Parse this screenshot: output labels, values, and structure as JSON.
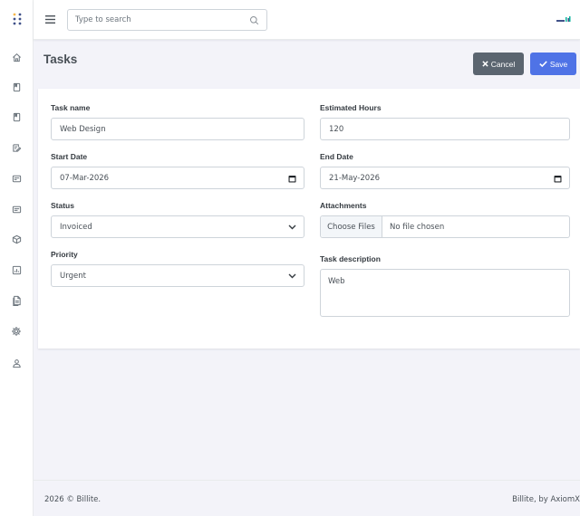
{
  "colors": {
    "accent": "#4f73e6",
    "cancel": "#5b6570",
    "logo": "#405189"
  },
  "sidebar": {
    "logo_icon": "dots-grid-icon",
    "items": [
      {
        "name": "home-icon"
      },
      {
        "name": "bookmark-icon"
      },
      {
        "name": "bookmark-outline-icon"
      },
      {
        "name": "edit-note-icon"
      },
      {
        "name": "wallet-icon"
      },
      {
        "name": "receipt-icon"
      },
      {
        "name": "box-icon"
      },
      {
        "name": "chart-icon"
      },
      {
        "name": "document-icon"
      },
      {
        "name": "settings-icon"
      },
      {
        "name": "user-icon"
      }
    ]
  },
  "topbar": {
    "search": {
      "placeholder": "Type to search",
      "value": ""
    }
  },
  "page": {
    "title": "Tasks",
    "cancel_label": "Cancel",
    "save_label": "Save"
  },
  "form": {
    "task_name": {
      "label": "Task name",
      "value": "Web Design"
    },
    "estimated_hours": {
      "label": "Estimated Hours",
      "value": "120"
    },
    "start_date": {
      "label": "Start Date",
      "value": "07-Mar-2026"
    },
    "end_date": {
      "label": "End Date",
      "value": "21-May-2026"
    },
    "status": {
      "label": "Status",
      "value": "Invoiced"
    },
    "attachments": {
      "label": "Attachments",
      "button": "Choose Files",
      "text": "No file chosen"
    },
    "priority": {
      "label": "Priority",
      "value": "Urgent"
    },
    "task_description": {
      "label": "Task description",
      "value": "Web"
    }
  },
  "footer": {
    "copyright": "2026 © Billite.",
    "credit": "Billite, by AxiomX"
  }
}
